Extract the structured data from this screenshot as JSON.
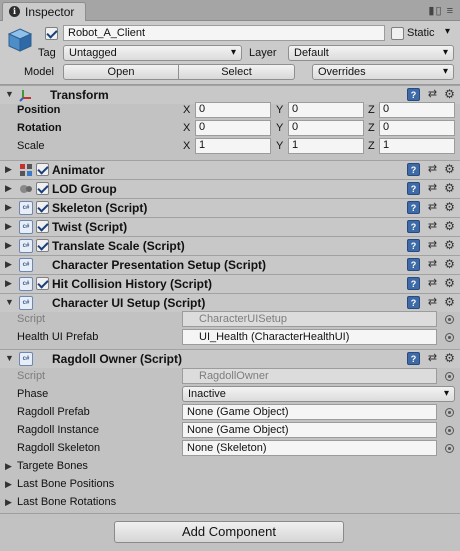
{
  "tab": {
    "label": "Inspector",
    "icons": "▮▯ ≡"
  },
  "header": {
    "object_name": "Robot_A_Client",
    "static_label": "Static",
    "tag_label": "Tag",
    "tag_value": "Untagged",
    "layer_label": "Layer",
    "layer_value": "Default",
    "model_label": "Model",
    "open_label": "Open",
    "select_label": "Select",
    "overrides_label": "Overrides"
  },
  "transform": {
    "title": "Transform",
    "rows": [
      {
        "label": "Position",
        "x": "0",
        "y": "0",
        "z": "0"
      },
      {
        "label": "Rotation",
        "x": "0",
        "y": "0",
        "z": "0"
      },
      {
        "label": "Scale",
        "x": "1",
        "y": "1",
        "z": "1"
      }
    ],
    "axes": {
      "x": "X",
      "y": "Y",
      "z": "Z"
    }
  },
  "components": {
    "animator": "Animator",
    "lod": "LOD Group",
    "skeleton": "Skeleton (Script)",
    "twist": "Twist (Script)",
    "translate": "Translate Scale (Script)",
    "char_pres": "Character Presentation Setup (Script)",
    "hit_hist": "Hit Collision History (Script)",
    "char_ui": "Character UI Setup (Script)",
    "ragdoll": "Ragdoll Owner (Script)"
  },
  "char_ui": {
    "script_label": "Script",
    "script_value": "CharacterUISetup",
    "health_label": "Health UI Prefab",
    "health_value": "UI_Health (CharacterHealthUI)"
  },
  "ragdoll": {
    "script_label": "Script",
    "script_value": "RagdollOwner",
    "phase_label": "Phase",
    "phase_value": "Inactive",
    "prefab_label": "Ragdoll Prefab",
    "prefab_value": "None (Game Object)",
    "instance_label": "Ragdoll Instance",
    "instance_value": "None (Game Object)",
    "skeleton_label": "Ragdoll Skeleton",
    "skeleton_value": "None (Skeleton)",
    "fold1": "Targete Bones",
    "fold2": "Last Bone Positions",
    "fold3": "Last Bone Rotations"
  },
  "add_component": "Add Component",
  "icons": {
    "help": "?",
    "preset": "⇄",
    "gear": "⚙",
    "script_tag": "c#",
    "arrow_open": "▼",
    "arrow_closed": "▶",
    "lock": "🔒"
  }
}
